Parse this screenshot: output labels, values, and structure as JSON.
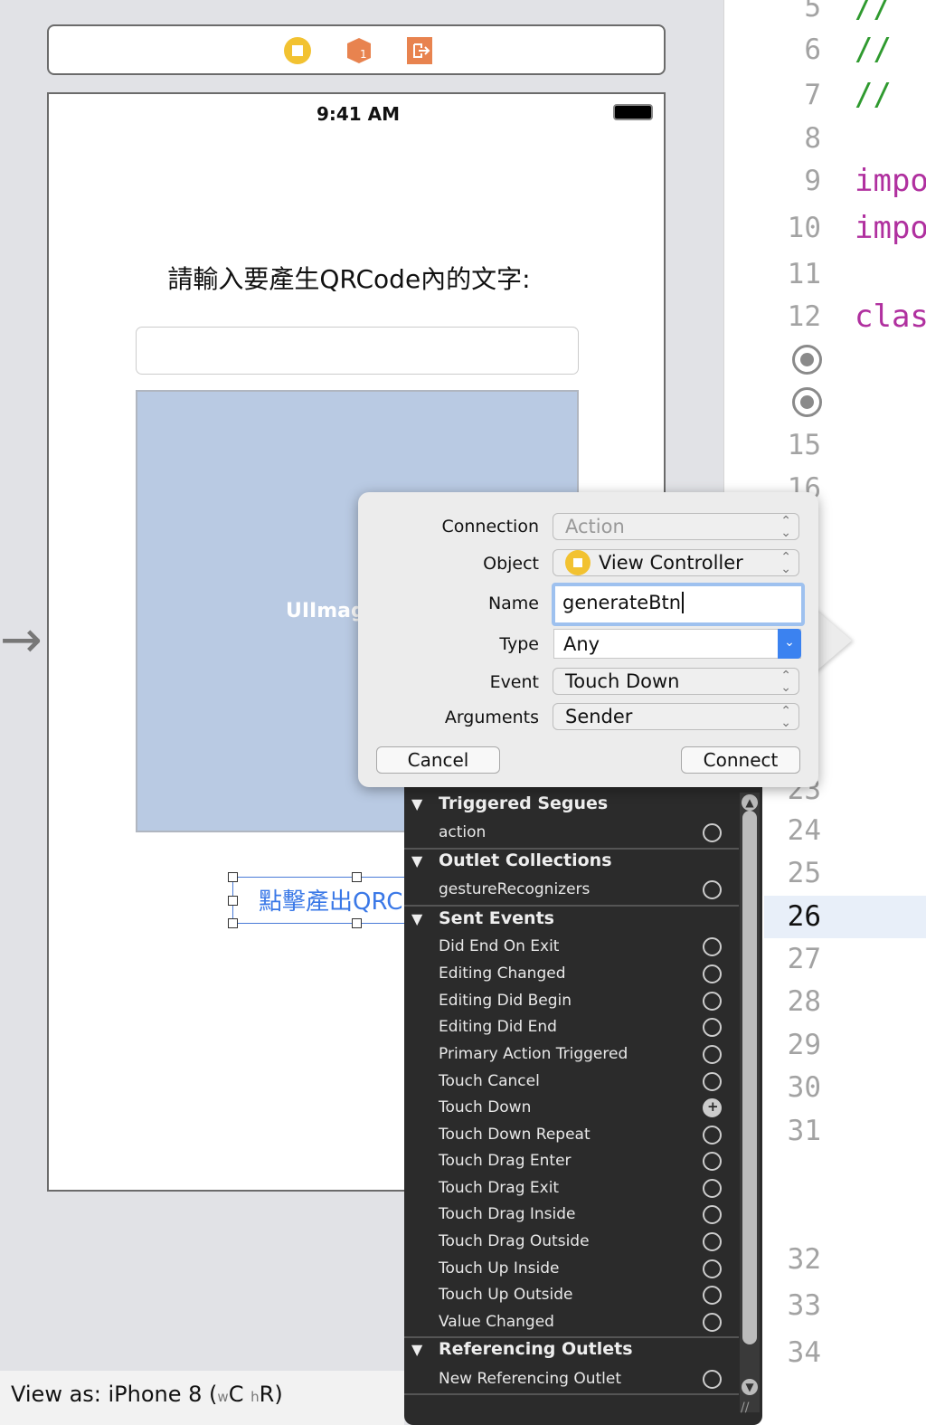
{
  "scene_bar": {
    "icons": [
      "view-controller-icon",
      "first-responder-icon",
      "exit-icon"
    ]
  },
  "phone": {
    "time": "9:41 AM",
    "prompt_label": "請輸入要產生QRCode內的文字:",
    "image_view_label": "UIImag",
    "button_label": "點擊產出QRC"
  },
  "view_as": {
    "prefix": "View as: iPhone 8 (",
    "w": "w",
    "wc": "C",
    "h": "h",
    "hr": "R",
    "suffix": ")"
  },
  "editor": {
    "lines": [
      {
        "n": "5",
        "code": "//",
        "kind": "comment"
      },
      {
        "n": "6",
        "code": "//",
        "kind": "comment"
      },
      {
        "n": "7",
        "code": "//",
        "kind": "comment"
      },
      {
        "n": "8",
        "code": "",
        "kind": ""
      },
      {
        "n": "9",
        "code": "impo",
        "kind": "keyword"
      },
      {
        "n": "10",
        "code": "impo",
        "kind": "keyword"
      },
      {
        "n": "11",
        "code": "",
        "kind": ""
      },
      {
        "n": "12",
        "code": "clas",
        "kind": "keyword"
      },
      {
        "n": "",
        "code": "",
        "kind": "outlet"
      },
      {
        "n": "",
        "code": "",
        "kind": "outlet"
      },
      {
        "n": "15",
        "code": "",
        "kind": ""
      },
      {
        "n": "16",
        "code": "",
        "kind": ""
      },
      {
        "n": "23",
        "code": "",
        "kind": ""
      },
      {
        "n": "24",
        "code": "",
        "kind": ""
      },
      {
        "n": "25",
        "code": "",
        "kind": ""
      },
      {
        "n": "26",
        "code": "",
        "kind": "current"
      },
      {
        "n": "27",
        "code": "",
        "kind": ""
      },
      {
        "n": "28",
        "code": "",
        "kind": ""
      },
      {
        "n": "29",
        "code": "",
        "kind": ""
      },
      {
        "n": "30",
        "code": "",
        "kind": ""
      },
      {
        "n": "31",
        "code": "",
        "kind": ""
      },
      {
        "n": "32",
        "code": "",
        "kind": ""
      },
      {
        "n": "33",
        "code": "",
        "kind": ""
      },
      {
        "n": "34",
        "code": "",
        "kind": ""
      }
    ],
    "colors": {
      "comment": "#2f9a2f",
      "keyword": "#b0309f",
      "current_line": "#e8eff9"
    }
  },
  "popover": {
    "connection_label": "Connection",
    "connection_value": "Action",
    "object_label": "Object",
    "object_value": "View Controller",
    "name_label": "Name",
    "name_value": "generateBtn",
    "type_label": "Type",
    "type_value": "Any",
    "event_label": "Event",
    "event_value": "Touch Down",
    "arguments_label": "Arguments",
    "arguments_value": "Sender",
    "cancel": "Cancel",
    "connect": "Connect",
    "accent": "#3b82f0"
  },
  "connections_hud": {
    "rows": [
      {
        "type": "section",
        "label": "Triggered Segues"
      },
      {
        "type": "item",
        "label": "action"
      },
      {
        "type": "section",
        "label": "Outlet Collections"
      },
      {
        "type": "item",
        "label": "gestureRecognizers"
      },
      {
        "type": "section",
        "label": "Sent Events"
      },
      {
        "type": "item",
        "label": "Did End On Exit"
      },
      {
        "type": "item",
        "label": "Editing Changed"
      },
      {
        "type": "item",
        "label": "Editing Did Begin"
      },
      {
        "type": "item",
        "label": "Editing Did End"
      },
      {
        "type": "item",
        "label": "Primary Action Triggered"
      },
      {
        "type": "item",
        "label": "Touch Cancel"
      },
      {
        "type": "item",
        "label": "Touch Down",
        "connected": true
      },
      {
        "type": "item",
        "label": "Touch Down Repeat"
      },
      {
        "type": "item",
        "label": "Touch Drag Enter"
      },
      {
        "type": "item",
        "label": "Touch Drag Exit"
      },
      {
        "type": "item",
        "label": "Touch Drag Inside"
      },
      {
        "type": "item",
        "label": "Touch Drag Outside"
      },
      {
        "type": "item",
        "label": "Touch Up Inside"
      },
      {
        "type": "item",
        "label": "Touch Up Outside"
      },
      {
        "type": "item",
        "label": "Value Changed"
      },
      {
        "type": "section",
        "label": "Referencing Outlets"
      },
      {
        "type": "item",
        "label": "New Referencing Outlet"
      }
    ]
  }
}
